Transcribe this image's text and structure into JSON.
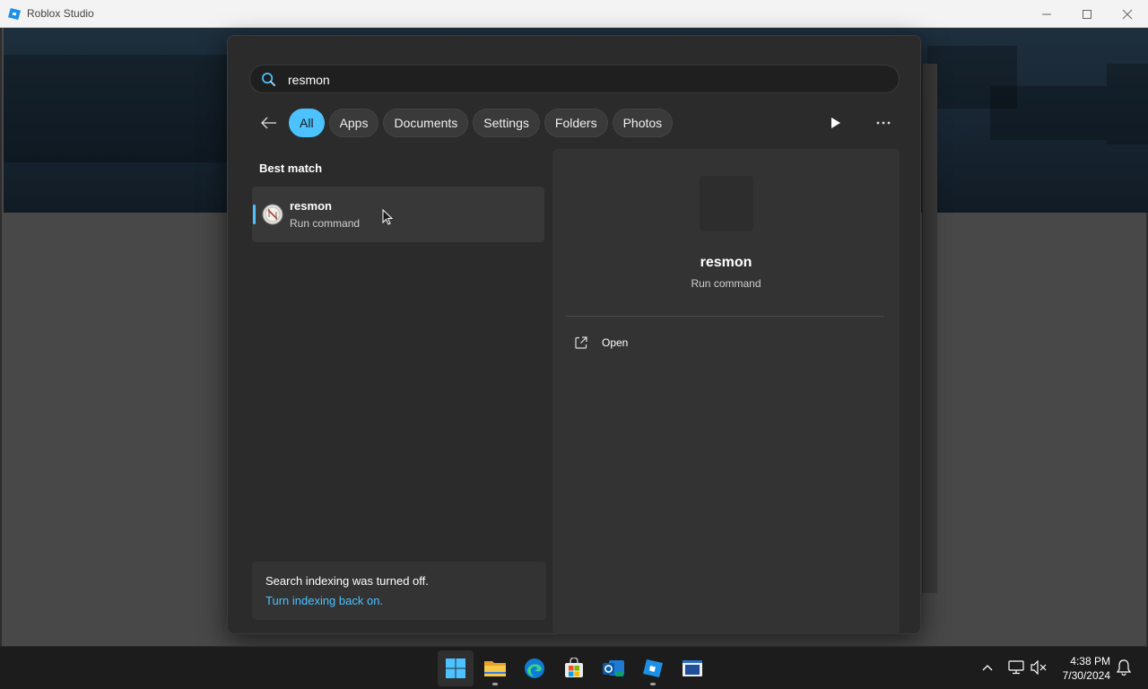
{
  "window": {
    "title": "Roblox Studio",
    "minimize": "—",
    "maximize": "☐",
    "close": "✕"
  },
  "search": {
    "query": "resmon",
    "filters": [
      {
        "label": "All",
        "active": true
      },
      {
        "label": "Apps",
        "active": false
      },
      {
        "label": "Documents",
        "active": false
      },
      {
        "label": "Settings",
        "active": false
      },
      {
        "label": "Folders",
        "active": false
      },
      {
        "label": "Photos",
        "active": false
      }
    ]
  },
  "results": {
    "section_title": "Best match",
    "best_match": {
      "name": "resmon",
      "type": "Run command"
    }
  },
  "notice": {
    "message": "Search indexing was turned off.",
    "link": "Turn indexing back on."
  },
  "preview": {
    "name": "resmon",
    "type": "Run command",
    "actions": [
      {
        "label": "Open",
        "icon": "open-external-icon"
      }
    ]
  },
  "taskbar": {
    "items": [
      "start-icon",
      "file-explorer-icon",
      "edge-icon",
      "store-icon",
      "outlook-icon",
      "roblox-studio-icon",
      "terminal-window-icon"
    ],
    "time": "4:38 PM",
    "date": "7/30/2024"
  },
  "colors": {
    "accent": "#4cc2ff",
    "flyout_bg": "#2b2b2b",
    "taskbar_bg": "#1c1c1c"
  }
}
